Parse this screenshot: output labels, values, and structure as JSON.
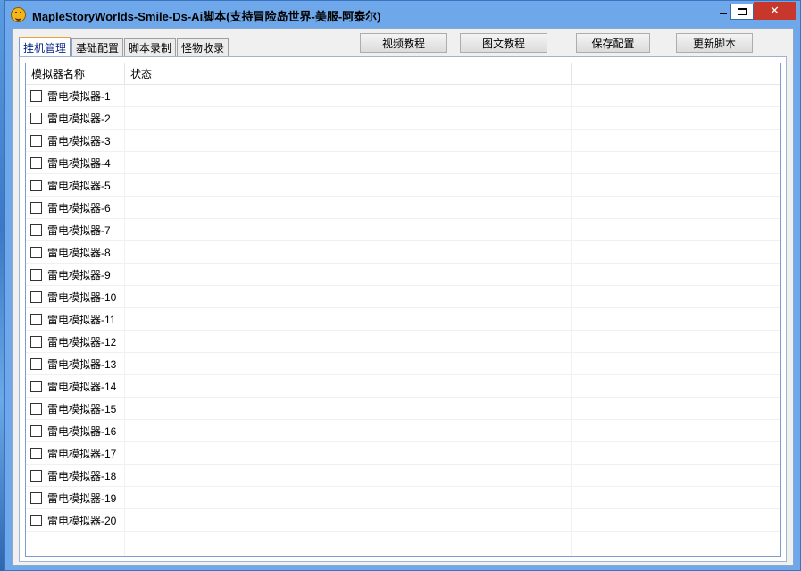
{
  "window": {
    "title": "MapleStoryWorlds-Smile-Ds-Ai脚本(支持冒险岛世界-美服-阿泰尔)",
    "close_glyph": "✕"
  },
  "tabs": [
    {
      "label": "挂机管理",
      "active": true
    },
    {
      "label": "基础配置",
      "active": false
    },
    {
      "label": "脚本录制",
      "active": false
    },
    {
      "label": "怪物收录",
      "active": false
    }
  ],
  "toolbar": {
    "video_tutorial": "视频教程",
    "image_tutorial": "图文教程",
    "save_config": "保存配置",
    "update_script": "更新脚本"
  },
  "list": {
    "columns": [
      "模拟器名称",
      "状态",
      ""
    ],
    "rows": [
      {
        "name": "雷电模拟器-1",
        "checked": false,
        "status": ""
      },
      {
        "name": "雷电模拟器-2",
        "checked": false,
        "status": ""
      },
      {
        "name": "雷电模拟器-3",
        "checked": false,
        "status": ""
      },
      {
        "name": "雷电模拟器-4",
        "checked": false,
        "status": ""
      },
      {
        "name": "雷电模拟器-5",
        "checked": false,
        "status": ""
      },
      {
        "name": "雷电模拟器-6",
        "checked": false,
        "status": ""
      },
      {
        "name": "雷电模拟器-7",
        "checked": false,
        "status": ""
      },
      {
        "name": "雷电模拟器-8",
        "checked": false,
        "status": ""
      },
      {
        "name": "雷电模拟器-9",
        "checked": false,
        "status": ""
      },
      {
        "name": "雷电模拟器-10",
        "checked": false,
        "status": ""
      },
      {
        "name": "雷电模拟器-11",
        "checked": false,
        "status": ""
      },
      {
        "name": "雷电模拟器-12",
        "checked": false,
        "status": ""
      },
      {
        "name": "雷电模拟器-13",
        "checked": false,
        "status": ""
      },
      {
        "name": "雷电模拟器-14",
        "checked": false,
        "status": ""
      },
      {
        "name": "雷电模拟器-15",
        "checked": false,
        "status": ""
      },
      {
        "name": "雷电模拟器-16",
        "checked": false,
        "status": ""
      },
      {
        "name": "雷电模拟器-17",
        "checked": false,
        "status": ""
      },
      {
        "name": "雷电模拟器-18",
        "checked": false,
        "status": ""
      },
      {
        "name": "雷电模拟器-19",
        "checked": false,
        "status": ""
      },
      {
        "name": "雷电模拟器-20",
        "checked": false,
        "status": ""
      }
    ]
  }
}
